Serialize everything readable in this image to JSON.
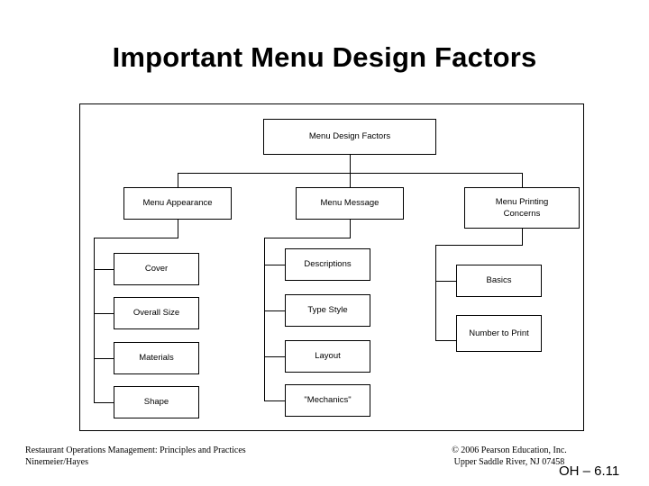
{
  "slide": {
    "title": "Important Menu Design Factors",
    "oh_label": "OH – 6.11"
  },
  "chart_data": {
    "type": "diagram",
    "title": "Important Menu Design Factors",
    "layout": "org-chart",
    "root": "Menu Design Factors",
    "branches": [
      {
        "label": "Menu Appearance",
        "children": [
          "Cover",
          "Overall Size",
          "Materials",
          "Shape"
        ]
      },
      {
        "label": "Menu Message",
        "children": [
          "Descriptions",
          "Type Style",
          "Layout",
          "\"Mechanics\""
        ]
      },
      {
        "label": "Menu Printing Concerns",
        "children": [
          "Basics",
          "Number to Print"
        ]
      }
    ]
  },
  "nodes": {
    "root": "Menu Design Factors",
    "branch1": "Menu Appearance",
    "branch2": "Menu Message",
    "branch3_line1": "Menu Printing",
    "branch3_line2": "Concerns",
    "a1": "Cover",
    "a2": "Overall Size",
    "a3": "Materials",
    "a4": "Shape",
    "b1": "Descriptions",
    "b2": "Type Style",
    "b3": "Layout",
    "b4": "\"Mechanics\"",
    "c1": "Basics",
    "c2": "Number to Print"
  },
  "footer": {
    "left_line1": "Restaurant Operations Management: Principles and Practices",
    "left_line2": "Ninemeier/Hayes",
    "right_line1": "© 2006 Pearson Education, Inc.",
    "right_line2": "Upper Saddle River, NJ 07458"
  }
}
